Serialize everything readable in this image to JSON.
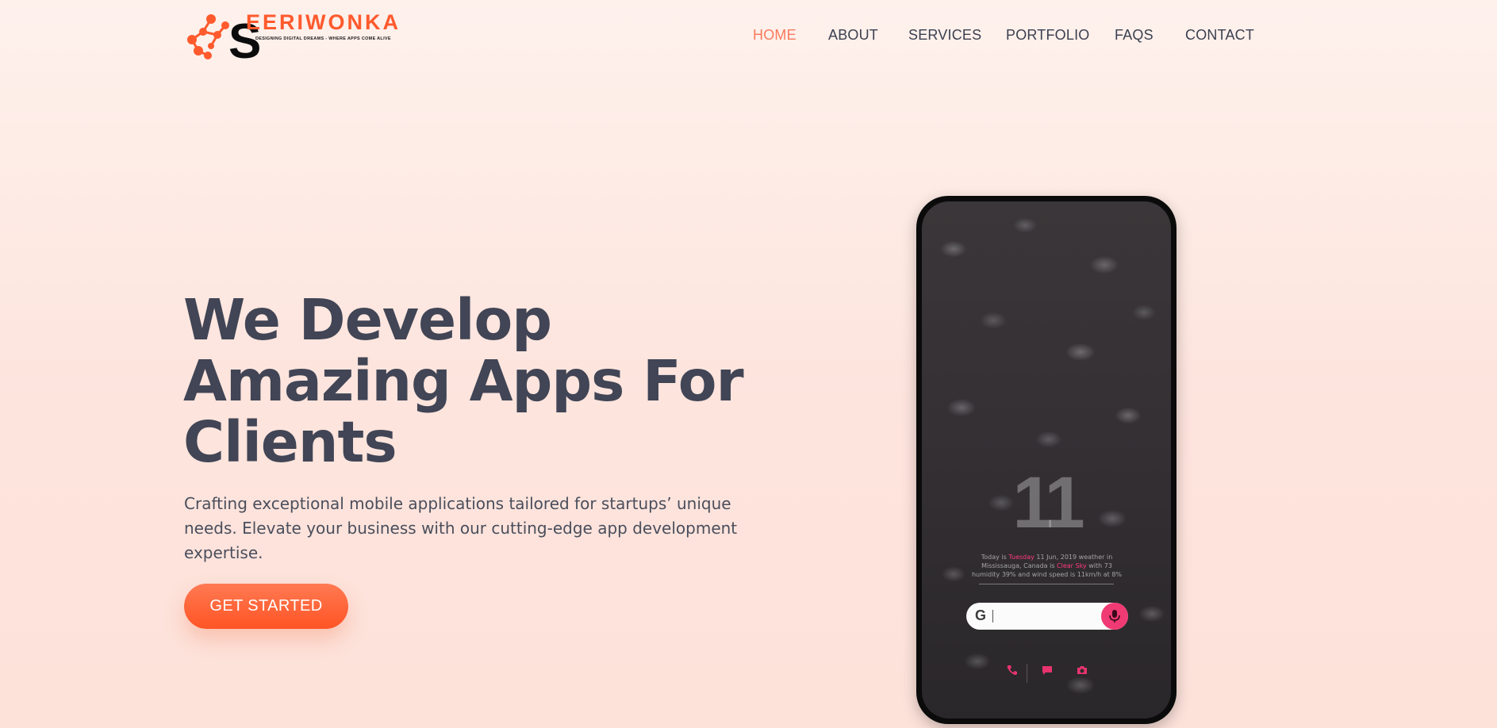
{
  "brand": {
    "name": "EERIWONKA",
    "initial": "S",
    "tagline": "DESIGNING DIGITAL DREAMS - WHERE APPS COME ALIVE",
    "color": "#ff5a2d"
  },
  "nav": {
    "items": [
      {
        "label": "HOME",
        "active": true
      },
      {
        "label": "ABOUT",
        "active": false
      },
      {
        "label": "SERVICES",
        "active": false
      },
      {
        "label": "PORTFOLIO",
        "active": false
      },
      {
        "label": "FAQS",
        "active": false
      },
      {
        "label": "CONTACT",
        "active": false
      }
    ],
    "active_color": "#fb7a5c",
    "text_color": "#3a3f50"
  },
  "hero": {
    "title_lines": [
      "We Develop",
      "Amazing Apps For",
      "Clients"
    ],
    "description": "Crafting exceptional mobile applications tailored for startups’ unique needs. Elevate your business with our cutting-edge app development expertise.",
    "cta_label": "GET STARTED"
  },
  "phone": {
    "clock": "11",
    "weather": {
      "line1_a": "Today is ",
      "line1_b": "Tuesday",
      "line1_c": " 11 Jun, 2019 weather in",
      "line2_a": "Mississauga, Canada is ",
      "line2_b": "Clear Sky",
      "line2_c": " with 73",
      "line3": "humidity 39% and wind speed is 11km/h at 8%"
    },
    "search_letter": "G",
    "accent": "#ef3a73"
  }
}
